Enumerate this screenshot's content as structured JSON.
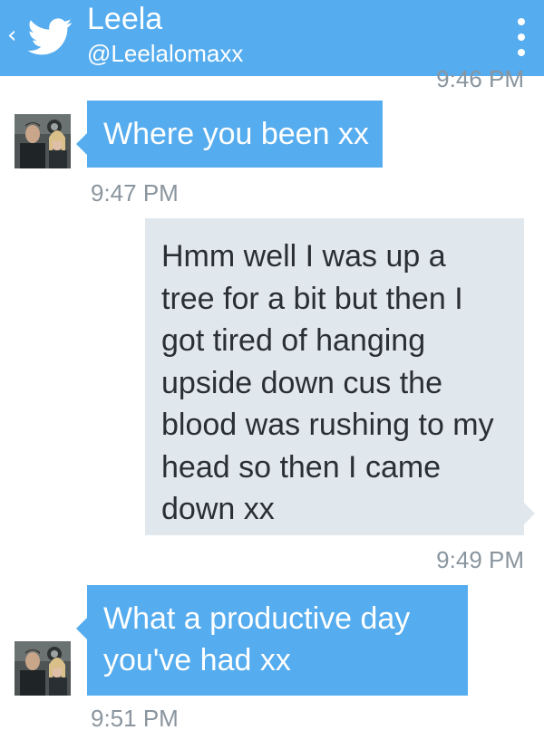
{
  "header": {
    "back_icon": "chevron-left-icon",
    "logo_icon": "twitter-bird-icon",
    "name": "Leela",
    "handle": "@Leelalomaxx",
    "menu_icon": "overflow-menu-icon",
    "background": "#55acee"
  },
  "partial_timestamp": "9:46 PM",
  "messages": [
    {
      "direction": "incoming",
      "text": "Where you been xx",
      "time": "9:47 PM"
    },
    {
      "direction": "outgoing",
      "lines": [
        "Hmm well I was up a",
        "tree for a bit but then I",
        "got tired of hanging",
        "upside down cus the",
        "blood was rushing to my",
        "head so then I came",
        "down xx"
      ],
      "time": "9:49 PM"
    },
    {
      "direction": "incoming",
      "lines": [
        "What a productive day",
        "you've had xx"
      ],
      "time": "9:51 PM"
    }
  ],
  "colors": {
    "incoming_bubble": "#55acee",
    "outgoing_bubble": "#e1e8ed",
    "timestamp": "#8a959e"
  }
}
